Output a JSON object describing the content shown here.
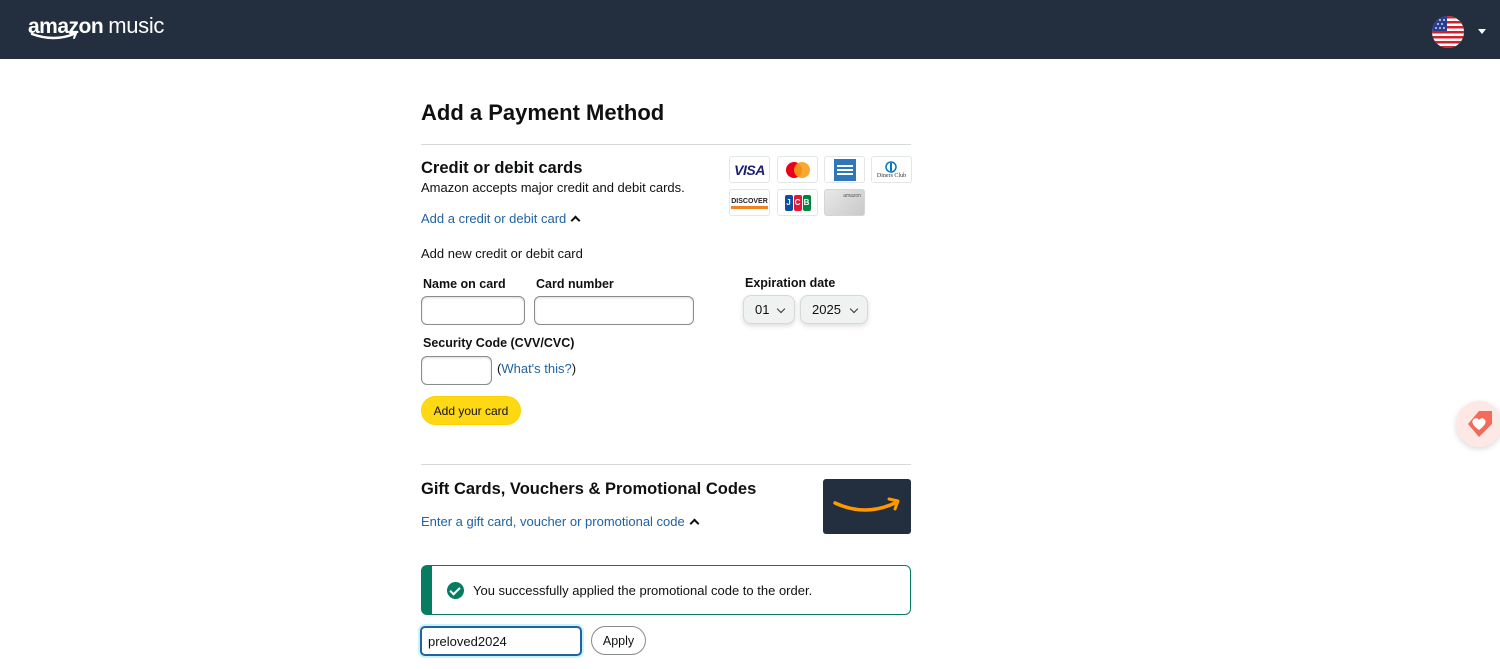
{
  "header": {
    "logo_brand": "amazon",
    "logo_product": "music",
    "locale_icon": "us-flag-icon"
  },
  "page": {
    "title": "Add a Payment Method"
  },
  "cards_section": {
    "heading": "Credit or debit cards",
    "subtitle": "Amazon accepts major credit and debit cards.",
    "toggle_link": "Add a credit or debit card",
    "form_caption": "Add new credit or debit card",
    "logos": [
      {
        "name": "visa",
        "label": "VISA"
      },
      {
        "name": "mastercard",
        "label": ""
      },
      {
        "name": "amex",
        "label": ""
      },
      {
        "name": "diners-club",
        "label": "Diners Club"
      },
      {
        "name": "discover",
        "label": "DISCOVER"
      },
      {
        "name": "jcb",
        "label": "JCB"
      },
      {
        "name": "amazon-store-card",
        "label": "amazon"
      }
    ],
    "fields": {
      "name_label": "Name on card",
      "number_label": "Card number",
      "expiry_label": "Expiration date",
      "expiry_month": "01",
      "expiry_year": "2025",
      "cvv_label": "Security Code (CVV/CVC)",
      "whats_this_prefix": "(",
      "whats_this": "What's this?",
      "whats_this_suffix": ")"
    },
    "submit_label": "Add your card"
  },
  "gift_section": {
    "heading": "Gift Cards, Vouchers & Promotional Codes",
    "toggle_link": "Enter a gift card, voucher or promotional code",
    "success_message": "You successfully applied the promotional code to the order.",
    "promo_value": "preloved2024",
    "apply_label": "Apply"
  },
  "colors": {
    "header_bg": "#232f3e",
    "link": "#2162a1",
    "primary_button": "#ffd814",
    "success": "#067d62"
  }
}
